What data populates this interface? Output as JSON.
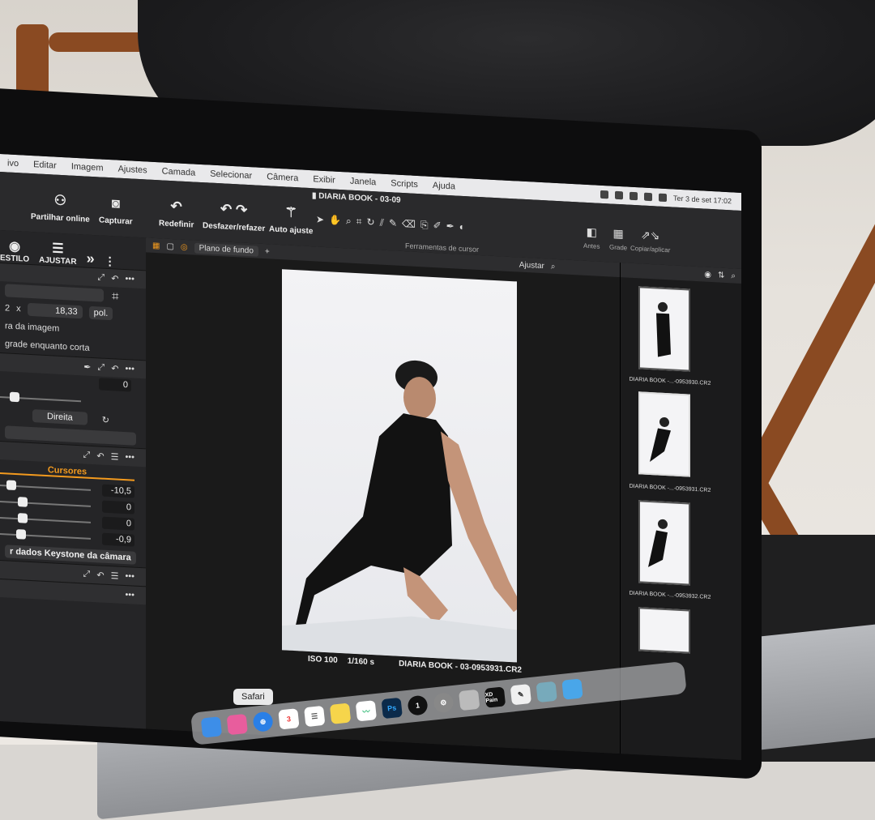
{
  "menubar": {
    "items": [
      "ivo",
      "Editar",
      "Imagem",
      "Ajustes",
      "Camada",
      "Selecionar",
      "Câmera",
      "Exibir",
      "Janela",
      "Scripts",
      "Ajuda"
    ],
    "clock": "Ter 3 de set  17:02"
  },
  "toolbar": {
    "document_title": "DIARIA BOOK - 03-09",
    "share": "Partilhar online",
    "capture": "Capturar",
    "reset": "Redefinir",
    "undo_redo": "Desfazer/refazer",
    "auto_adjust": "Auto ajuste",
    "cursor_tools_label": "Ferramentas de cursor",
    "before": "Antes",
    "grid": "Grade",
    "copy_apply": "Copiar/aplicar"
  },
  "left_panel": {
    "tab_style": "ESTILO",
    "tab_adjust": "AJUSTAR",
    "crop_x": "2",
    "crop_times": "x",
    "crop_height": "18,33",
    "crop_unit": "pol.",
    "crop_option1": "ra da imagem",
    "crop_option2": "grade enquanto corta",
    "rotation_value": "0",
    "flip_direction": "Direita",
    "cursors_title": "Cursores",
    "sliders": [
      "-10,5",
      "0",
      "0",
      "-0,9"
    ],
    "keystone_button": "r dados Keystone da câmara"
  },
  "viewer": {
    "background_select": "Plano de fundo",
    "fit_label": "Ajustar",
    "iso": "ISO 100",
    "shutter": "1/160 s",
    "filename": "DIARIA BOOK - 03-0953931.CR2"
  },
  "browser": {
    "thumbs": [
      "DIARIA BOOK -...-0953930.CR2",
      "DIARIA BOOK -...-0953931.CR2",
      "DIARIA BOOK -...-0953932.CR2"
    ]
  },
  "dock": {
    "tooltip": "Safari",
    "calendar_day": "3",
    "xd_label": "XD Pain"
  },
  "colors": {
    "accent_orange": "#f39a1e",
    "panel": "#252527",
    "menubar": "#e9e9eb"
  }
}
